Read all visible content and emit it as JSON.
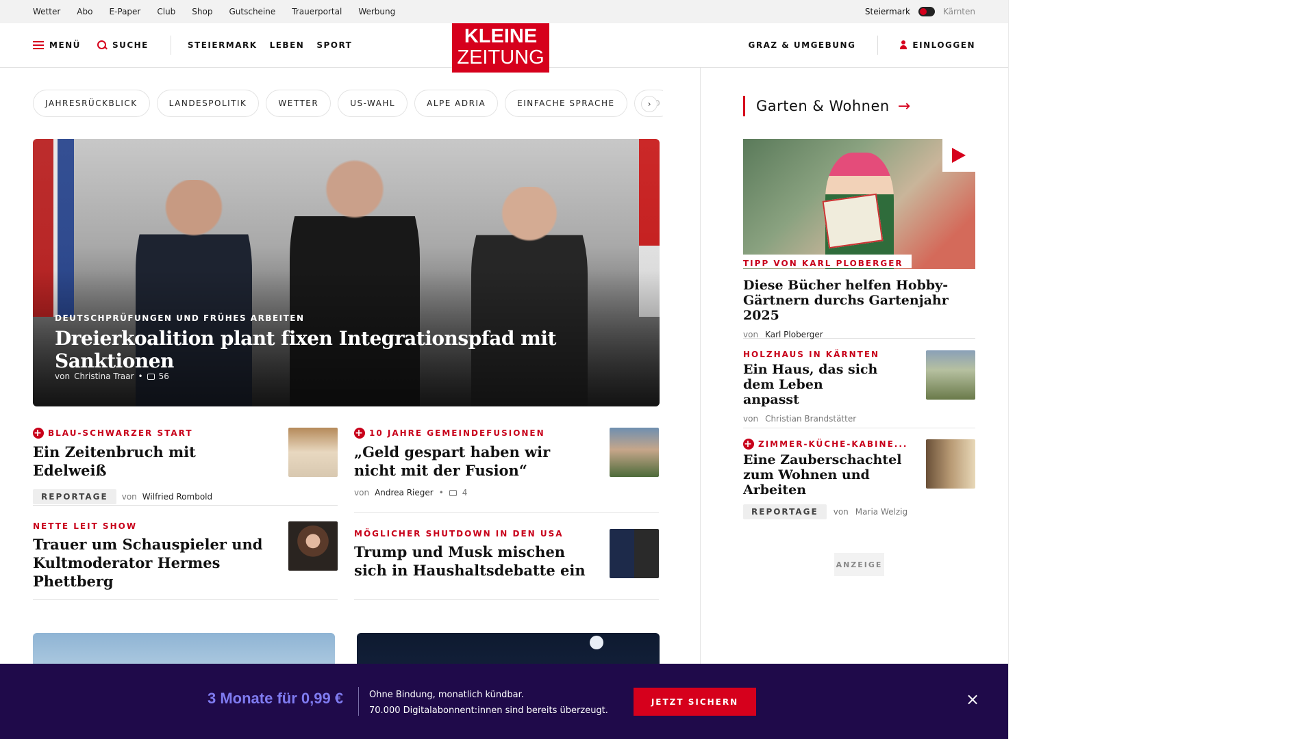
{
  "topbar": {
    "links": [
      "Wetter",
      "Abo",
      "E-Paper",
      "Club",
      "Shop",
      "Gutscheine",
      "Trauerportal",
      "Werbung"
    ],
    "region_active": "Steiermark",
    "region_inactive": "Kärnten"
  },
  "header": {
    "menu_label": "MENÜ",
    "search_label": "SUCHE",
    "nav": [
      "STEIERMARK",
      "LEBEN",
      "SPORT"
    ],
    "logo_line1": "KLEINE",
    "logo_line2": "ZEITUNG",
    "region_link": "GRAZ & UMGEBUNG",
    "login_label": "EINLOGGEN"
  },
  "topics": [
    "JAHRESRÜCKBLICK",
    "LANDESPOLITIK",
    "WETTER",
    "US-WAHL",
    "ALPE ADRIA",
    "EINFACHE SPRACHE",
    "DO"
  ],
  "topics_next": "›",
  "hero": {
    "kicker": "DEUTSCHPRÜFUNGEN UND FRÜHES ARBEITEN",
    "title": "Dreierkoalition plant fixen Integrationspfad mit Sanktionen",
    "by": "von",
    "author": "Christina Traar",
    "comments": "56"
  },
  "teasers": [
    {
      "kicker": "BLAU-SCHWARZER START",
      "plus": true,
      "title": "Ein Zeitenbruch mit Edelweiß",
      "tag": "REPORTAGE",
      "by": "von",
      "author": "Wilfried Rombold",
      "comments": ""
    },
    {
      "kicker": "10 JAHRE GEMEINDEFUSIONEN",
      "plus": true,
      "title": "„Geld gespart haben wir nicht mit der Fusion“",
      "tag": "",
      "by": "von",
      "author": "Andrea Rieger",
      "comments": "4"
    },
    {
      "kicker": "NETTE LEIT SHOW",
      "plus": false,
      "title": "Trauer um Schauspieler und Kultmoderator Hermes Phettberg",
      "tag": "",
      "by": "",
      "author": "",
      "comments": ""
    },
    {
      "kicker": "MÖGLICHER SHUTDOWN IN DEN USA",
      "plus": false,
      "title": "Trump und Musk mischen sich in Haushaltsdebatte ein",
      "tag": "",
      "by": "",
      "author": "",
      "comments": ""
    }
  ],
  "sidebar": {
    "heading": "Garten & Wohnen",
    "heading_arrow": "→",
    "feature": {
      "kicker": "TIPP VON KARL PLOBERGER",
      "title": "Diese Bücher helfen Hobby-Gärtnern durchs Gartenjahr 2025",
      "by": "von",
      "author": "Karl Ploberger"
    },
    "items": [
      {
        "kicker": "HOLZHAUS IN KÄRNTEN",
        "title": "Ein Haus, das sich dem Leben anpasst",
        "by": "von",
        "author": "Christian Brandstätter",
        "tag": ""
      },
      {
        "kicker": "ZIMMER-KÜCHE-KABINE...",
        "title": "Eine Zauberschachtel zum Wohnen und Arbeiten",
        "by": "von",
        "author": "Maria Welzig",
        "tag": "REPORTAGE"
      }
    ],
    "ad_label": "ANZEIGE"
  },
  "banner": {
    "offer": "3 Monate für 0,99 €",
    "line1": "Ohne Bindung, monatlich kündbar.",
    "line2": "70.000 Digitalabonnent:innen sind bereits überzeugt.",
    "cta": "JETZT SICHERN",
    "close": "×"
  },
  "colors": {
    "brand_red": "#d6001c",
    "banner_bg": "#1f0a4a",
    "offer_text": "#7f7bf0"
  }
}
